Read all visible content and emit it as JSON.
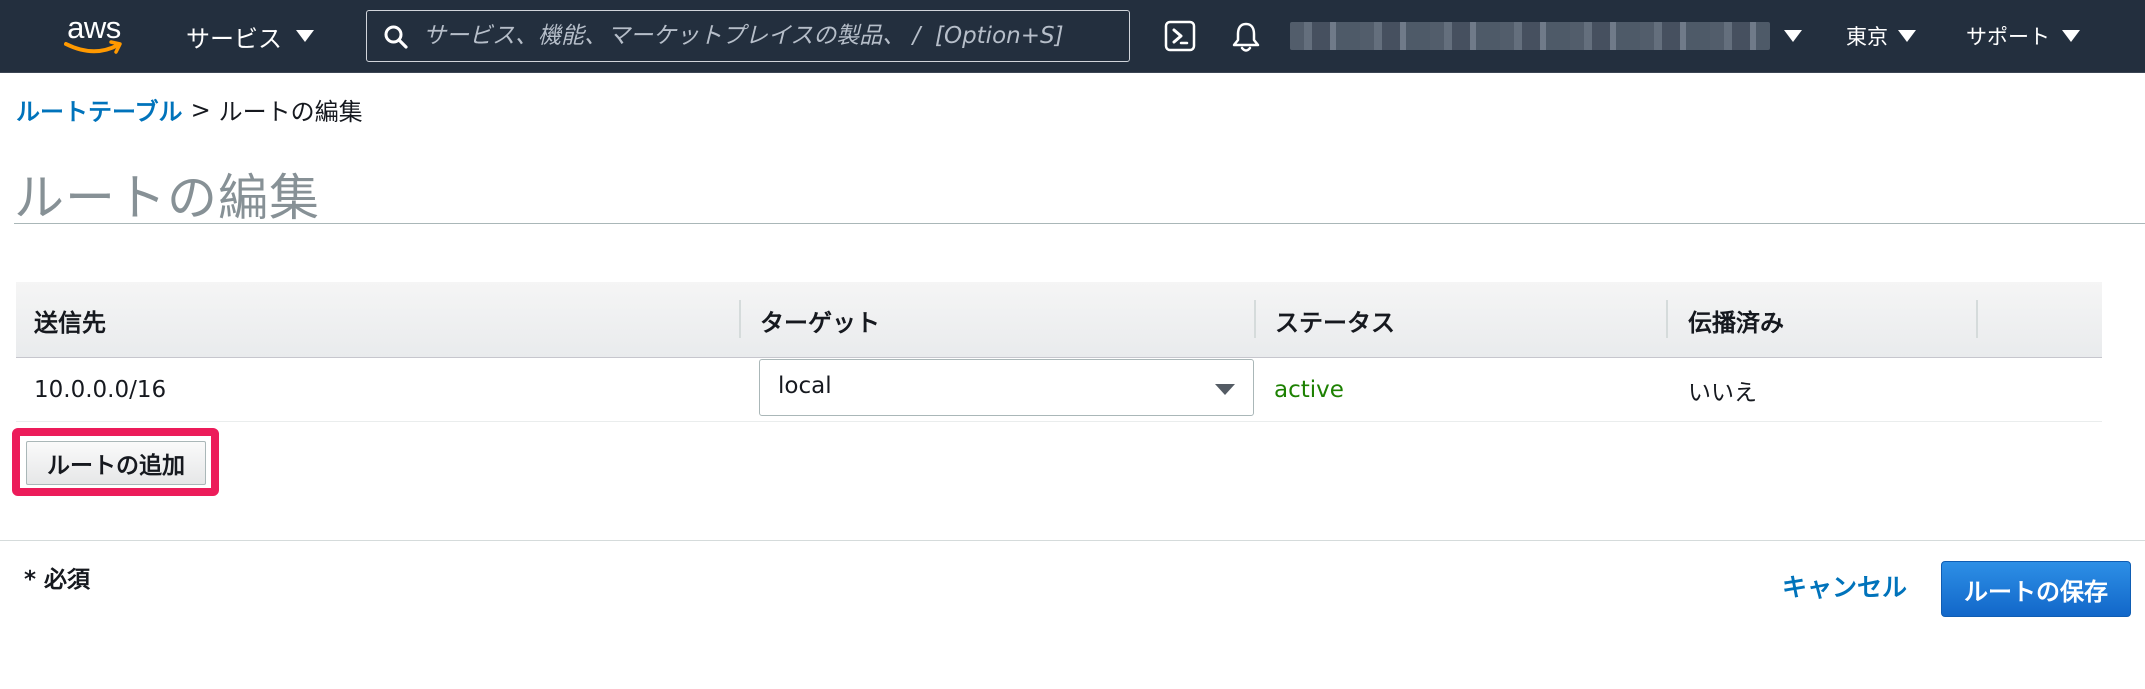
{
  "nav": {
    "logo_text": "aws",
    "services_label": "サービス",
    "search_placeholder": "サービス、機能、マーケットプレイスの製品、 /  [Option+S]",
    "region_label": "東京",
    "support_label": "サポート",
    "icons": [
      "cloudshell-icon",
      "bell-icon"
    ]
  },
  "breadcrumb": {
    "parent": "ルートテーブル",
    "separator": ">",
    "current": "ルートの編集"
  },
  "page": {
    "title": "ルートの編集"
  },
  "table": {
    "headers": [
      "送信先",
      "ターゲット",
      "ステータス",
      "伝播済み"
    ],
    "rows": [
      {
        "destination": "10.0.0.0/16",
        "target": "local",
        "status": "active",
        "propagated": "いいえ"
      }
    ]
  },
  "actions": {
    "add_route": "ルートの追加",
    "required_note": "* 必須",
    "cancel": "キャンセル",
    "save": "ルートの保存"
  },
  "colors": {
    "nav_bg": "#232f3e",
    "link": "#0073bb",
    "status_active": "#1d8102",
    "highlight": "#ec1c5a",
    "primary_button": "#1a73d9"
  }
}
